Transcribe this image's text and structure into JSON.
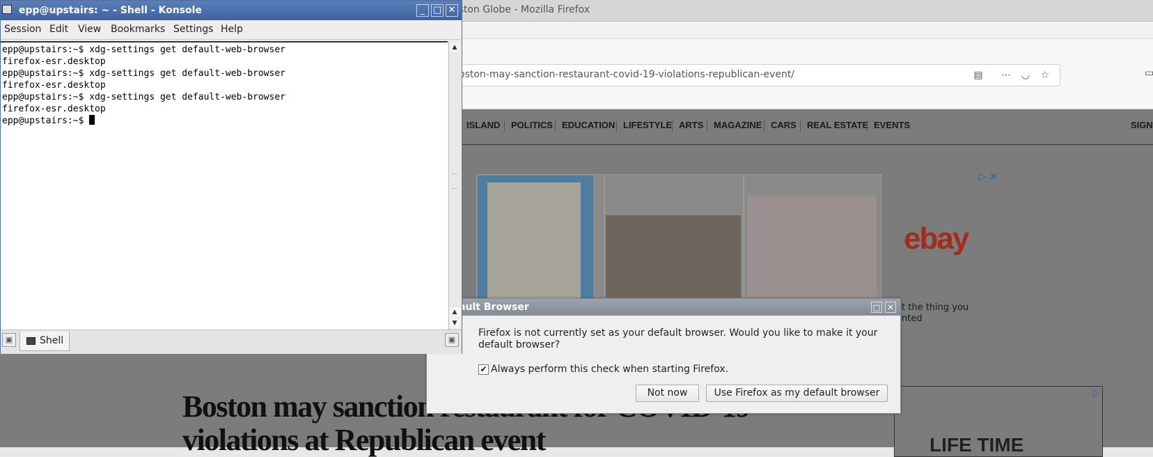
{
  "firefox": {
    "title": "oston Globe - Mozilla Firefox",
    "url": "oston-may-sanction-restaurant-covid-19-violations-republican-event/",
    "nav_items": [
      "ISLAND",
      "POLITICS",
      "EDUCATION",
      "LIFESTYLE",
      "ARTS",
      "MAGAZINE",
      "CARS",
      "REAL ESTATE",
      "EVENTS",
      "SIGN"
    ],
    "ad_logo": "ebay",
    "ad_text_line1": "t the thing you",
    "ad_text_line2": "nted",
    "ad_box2_text": "LIFE TIME",
    "headline": "Boston may sanction restaurant for COVID-19 violations at Republican event"
  },
  "dialog": {
    "title": "fault Browser",
    "message": "Firefox is not currently set as your default browser. Would you like to make it your default browser?",
    "checkbox_label": "Always perform this check when starting Firefox.",
    "checkbox_checked": true,
    "not_now": "Not now",
    "use_default": "Use Firefox as my default browser"
  },
  "konsole": {
    "title": "epp@upstairs: ~ - Shell - Konsole",
    "menu": [
      "Session",
      "Edit",
      "View",
      "Bookmarks",
      "Settings",
      "Help"
    ],
    "lines": [
      "epp@upstairs:~$ xdg-settings get default-web-browser",
      "firefox-esr.desktop",
      "epp@upstairs:~$ xdg-settings get default-web-browser",
      "firefox-esr.desktop",
      "epp@upstairs:~$ xdg-settings get default-web-browser",
      "firefox-esr.desktop"
    ],
    "prompt": "epp@upstairs:~$ ",
    "tab_label": "Shell"
  },
  "colors": {
    "konsole_titlebar": "#3e62a0",
    "dialog_titlebar": "#838c96",
    "ebay": "#a42c1c"
  }
}
